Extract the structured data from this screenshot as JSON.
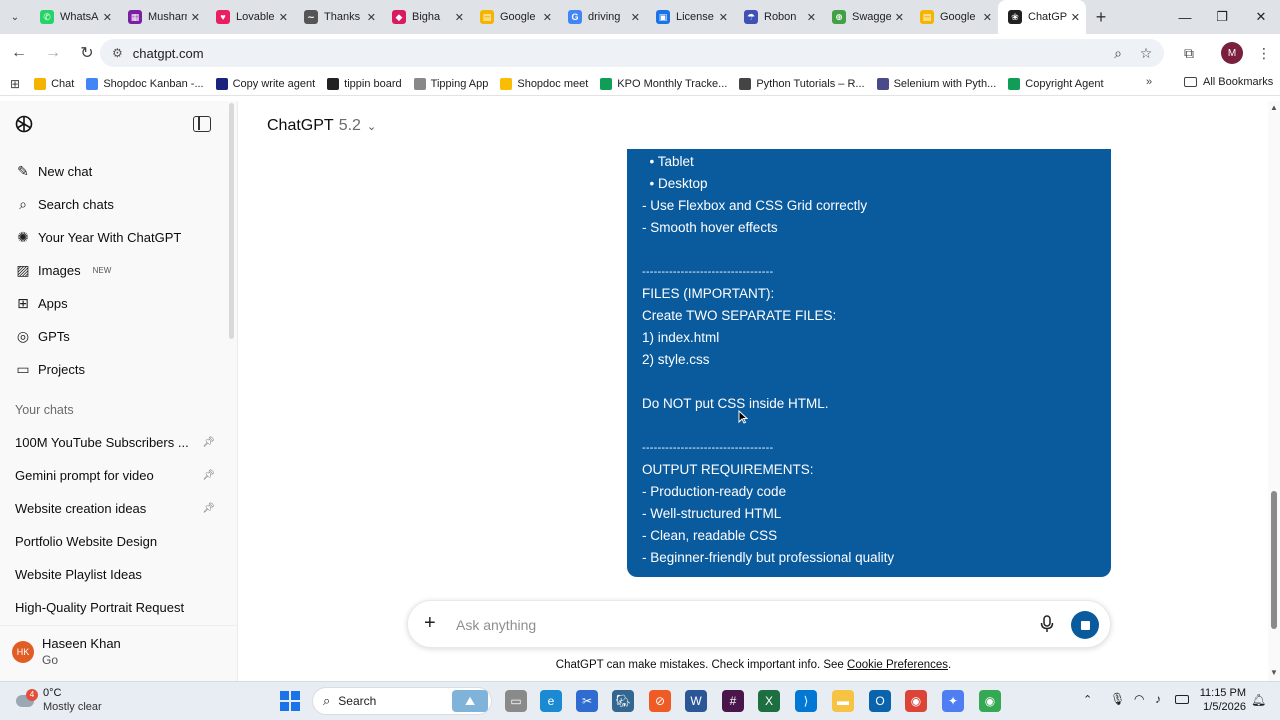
{
  "browser": {
    "tabs": [
      {
        "label": "WhatsApp",
        "color": "#25d366",
        "glyph": "✆"
      },
      {
        "label": "Musharraf",
        "color": "#7b1fa2",
        "glyph": "▦"
      },
      {
        "label": "Lovable",
        "color": "#e91e63",
        "glyph": "♥"
      },
      {
        "label": "Thanks",
        "color": "#555555",
        "glyph": "∼"
      },
      {
        "label": "Bigha",
        "color": "#d81b60",
        "glyph": "◆"
      },
      {
        "label": "Google",
        "color": "#f4b400",
        "glyph": "▤"
      },
      {
        "label": "driving",
        "color": "#4285f4",
        "glyph": "G"
      },
      {
        "label": "License",
        "color": "#1a73e8",
        "glyph": "▣"
      },
      {
        "label": "Robon",
        "color": "#3f51b5",
        "glyph": "☂"
      },
      {
        "label": "Swagger",
        "color": "#43a047",
        "glyph": "⊕"
      },
      {
        "label": "Google",
        "color": "#f4b400",
        "glyph": "▤"
      },
      {
        "label": "ChatGPT",
        "color": "#202123",
        "glyph": "❀"
      }
    ],
    "url": "chatgpt.com",
    "bookmarks": [
      {
        "label": "Chat",
        "color": "#f4b400"
      },
      {
        "label": "Shopdoc Kanban -...",
        "color": "#4285f4"
      },
      {
        "label": "Copy write agent",
        "color": "#1a237e"
      },
      {
        "label": "tippin board",
        "color": "#222222"
      },
      {
        "label": "Tipping App",
        "color": "#888888"
      },
      {
        "label": "Shopdoc meet",
        "color": "#fbbc04"
      },
      {
        "label": "KPO Monthly Tracke...",
        "color": "#0f9d58"
      },
      {
        "label": "Python Tutorials – R...",
        "color": "#444444"
      },
      {
        "label": "Selenium with Pyth...",
        "color": "#4a4a8a"
      },
      {
        "label": "Copyright Agent",
        "color": "#0f9d58"
      }
    ],
    "all_bookmarks": "All Bookmarks",
    "profile_initial": "M"
  },
  "sidebar": {
    "nav": [
      {
        "label": "New chat",
        "icon": "edit-icon"
      },
      {
        "label": "Search chats",
        "icon": "search-icon"
      },
      {
        "label": "Your Year With ChatGPT",
        "icon": "sparkle-icon"
      },
      {
        "label": "Images",
        "icon": "image-icon",
        "badge": "NEW"
      },
      {
        "label": "Apps",
        "icon": "apps-icon"
      },
      {
        "label": "GPTs",
        "icon": "gpts-icon"
      },
      {
        "label": "Projects",
        "icon": "folder-icon"
      }
    ],
    "section_title": "Your chats",
    "chats": [
      {
        "label": "100M YouTube Subscribers ...",
        "pinned": true
      },
      {
        "label": "Gemini prompt for video",
        "pinned": true
      },
      {
        "label": "Website creation ideas",
        "pinned": true
      },
      {
        "label": "Portfolio Website Design",
        "pinned": false
      },
      {
        "label": "Website Playlist Ideas",
        "pinned": false
      },
      {
        "label": "High-Quality Portrait Request",
        "pinned": false
      }
    ],
    "user": {
      "initials": "HK",
      "name": "Haseen Khan",
      "plan": "Go"
    }
  },
  "main": {
    "model_name": "ChatGPT",
    "model_version": "5.2",
    "message_lines": [
      "  • Tablet",
      "  • Desktop",
      "- Use Flexbox and CSS Grid correctly",
      "- Smooth hover effects",
      "",
      "----------------------------------",
      "FILES (IMPORTANT):",
      "Create TWO SEPARATE FILES:",
      "1) index.html",
      "2) style.css",
      "",
      "Do NOT put CSS inside HTML.",
      "",
      "----------------------------------",
      "OUTPUT REQUIREMENTS:",
      "- Production-ready code",
      "- Well-structured HTML",
      "- Clean, readable CSS",
      "- Beginner-friendly but professional quality"
    ],
    "composer_placeholder": "Ask anything",
    "disclaimer_text": "ChatGPT can make mistakes. Check important info. See ",
    "disclaimer_link": "Cookie Preferences",
    "disclaimer_end": "."
  },
  "taskbar": {
    "weather_temp": "0°C",
    "weather_desc": "Mostly clear",
    "search_label": "Search",
    "time": "11:15 PM",
    "date": "1/5/2026"
  }
}
